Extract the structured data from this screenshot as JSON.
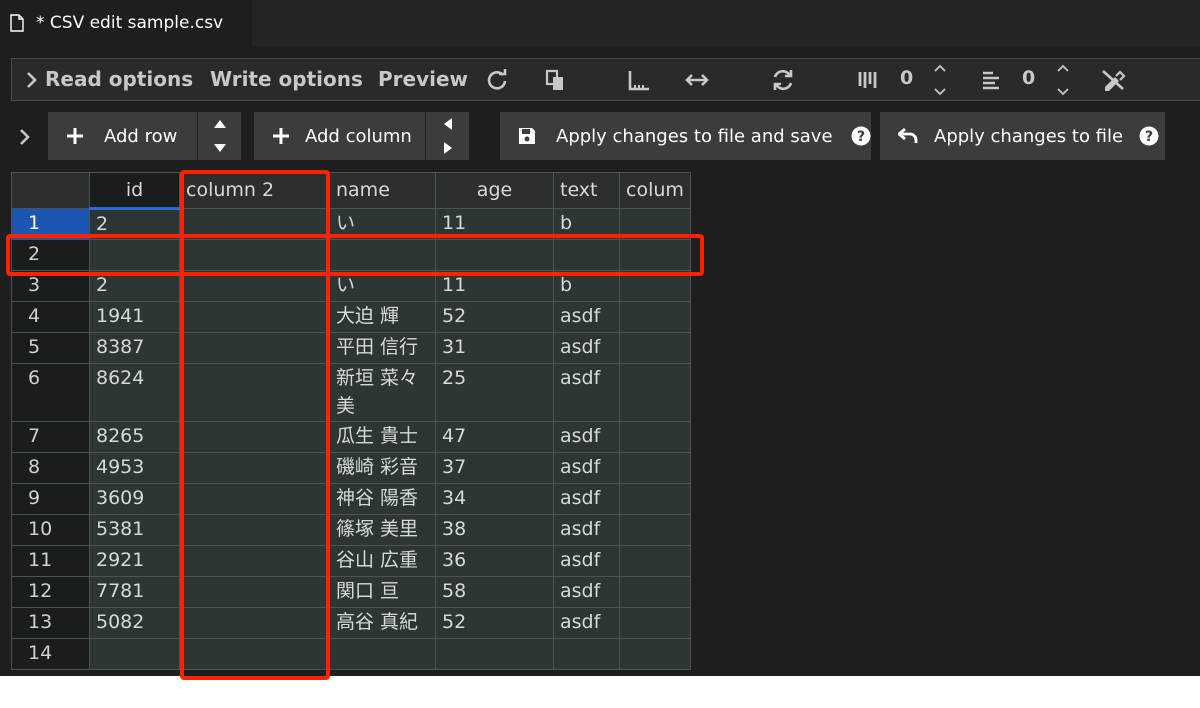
{
  "tab": {
    "title": "* CSV edit sample.csv",
    "icon": "file-icon"
  },
  "options_bar": {
    "read_options": "Read options",
    "write_options": "Write options",
    "preview": "Preview",
    "skip_rows_value": "0",
    "skip_cols_value": "0"
  },
  "toolbar": {
    "add_row": "Add row",
    "add_column": "Add column",
    "apply_save": "Apply changes to file and save",
    "apply": "Apply changes to file"
  },
  "grid": {
    "headers": [
      "id",
      "column 2",
      "name",
      "age",
      "text",
      "colum"
    ],
    "rows": [
      {
        "num": "1",
        "cells": [
          "2",
          "",
          "い",
          "11",
          "b",
          ""
        ]
      },
      {
        "num": "2",
        "cells": [
          "",
          "",
          "",
          "",
          "",
          ""
        ]
      },
      {
        "num": "3",
        "cells": [
          "2",
          "",
          "い",
          "11",
          "b",
          ""
        ]
      },
      {
        "num": "4",
        "cells": [
          "1941",
          "",
          "大迫 輝",
          "52",
          "asdf",
          ""
        ]
      },
      {
        "num": "5",
        "cells": [
          "8387",
          "",
          "平田 信行",
          "31",
          "asdf",
          ""
        ]
      },
      {
        "num": "6",
        "cells": [
          "8624",
          "",
          "新垣 菜々美",
          "25",
          "asdf",
          ""
        ]
      },
      {
        "num": "7",
        "cells": [
          "8265",
          "",
          "瓜生 貴士",
          "47",
          "asdf",
          ""
        ]
      },
      {
        "num": "8",
        "cells": [
          "4953",
          "",
          "磯崎 彩音",
          "37",
          "asdf",
          ""
        ]
      },
      {
        "num": "9",
        "cells": [
          "3609",
          "",
          "神谷 陽香",
          "34",
          "asdf",
          ""
        ]
      },
      {
        "num": "10",
        "cells": [
          "5381",
          "",
          "篠塚 美里",
          "38",
          "asdf",
          ""
        ]
      },
      {
        "num": "11",
        "cells": [
          "2921",
          "",
          "谷山 広重",
          "36",
          "asdf",
          ""
        ]
      },
      {
        "num": "12",
        "cells": [
          "7781",
          "",
          "関口 亘",
          "58",
          "asdf",
          ""
        ]
      },
      {
        "num": "13",
        "cells": [
          "5082",
          "",
          "高谷 真紀",
          "52",
          "asdf",
          ""
        ]
      },
      {
        "num": "14",
        "cells": [
          "",
          "",
          "",
          "",
          "",
          ""
        ]
      }
    ]
  },
  "colors": {
    "accent": "#1b56b5",
    "annotation": "#ff2200",
    "background": "#1e1e1e"
  }
}
